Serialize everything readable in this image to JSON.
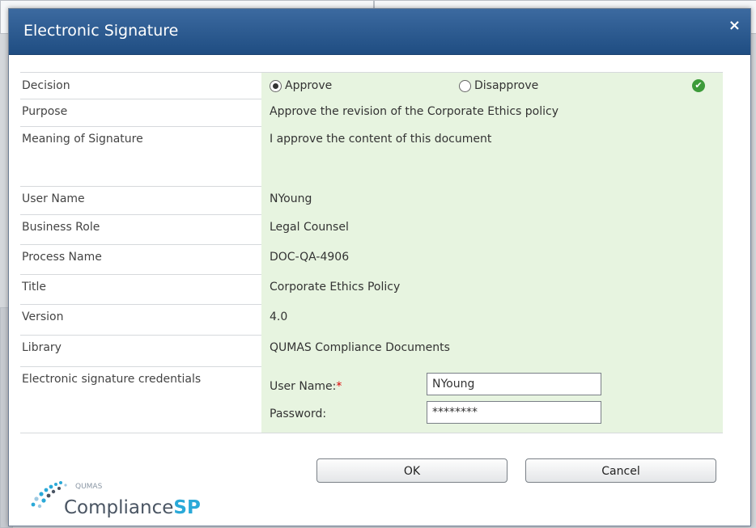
{
  "dialog": {
    "title": "Electronic Signature",
    "close_label": "×"
  },
  "rows": {
    "decision": {
      "label": "Decision",
      "approve": "Approve",
      "disapprove": "Disapprove"
    },
    "purpose": {
      "label": "Purpose",
      "value": "Approve the revision of the Corporate Ethics policy"
    },
    "meaning": {
      "label": "Meaning of Signature",
      "value": "I approve the content of this document"
    },
    "user_name": {
      "label": "User Name",
      "value": "NYoung"
    },
    "business_role": {
      "label": "Business Role",
      "value": "Legal Counsel"
    },
    "process_name": {
      "label": "Process Name",
      "value": "DOC-QA-4906"
    },
    "title": {
      "label": "Title",
      "value": "Corporate Ethics Policy"
    },
    "version": {
      "label": "Version",
      "value": "4.0"
    },
    "library": {
      "label": "Library",
      "value": "QUMAS Compliance Documents"
    },
    "credentials": {
      "label": "Electronic signature credentials",
      "user_name_label": "User Name:",
      "required_mark": "*",
      "password_label": "Password:",
      "user_name_value": "NYoung",
      "password_value": "********"
    }
  },
  "buttons": {
    "ok": "OK",
    "cancel": "Cancel"
  },
  "logo": {
    "small_text": "QUMAS",
    "text_main": "Compliance",
    "text_accent": "SP"
  },
  "icons": {
    "close": "close-icon",
    "check": "check-circle-icon",
    "logo": "qumas-dots-logo"
  },
  "colors": {
    "title_bar": "#1f4d82",
    "value_background": "#e7f4e0",
    "check": "#3d9b3a",
    "logo_accent": "#2aa9d8"
  }
}
